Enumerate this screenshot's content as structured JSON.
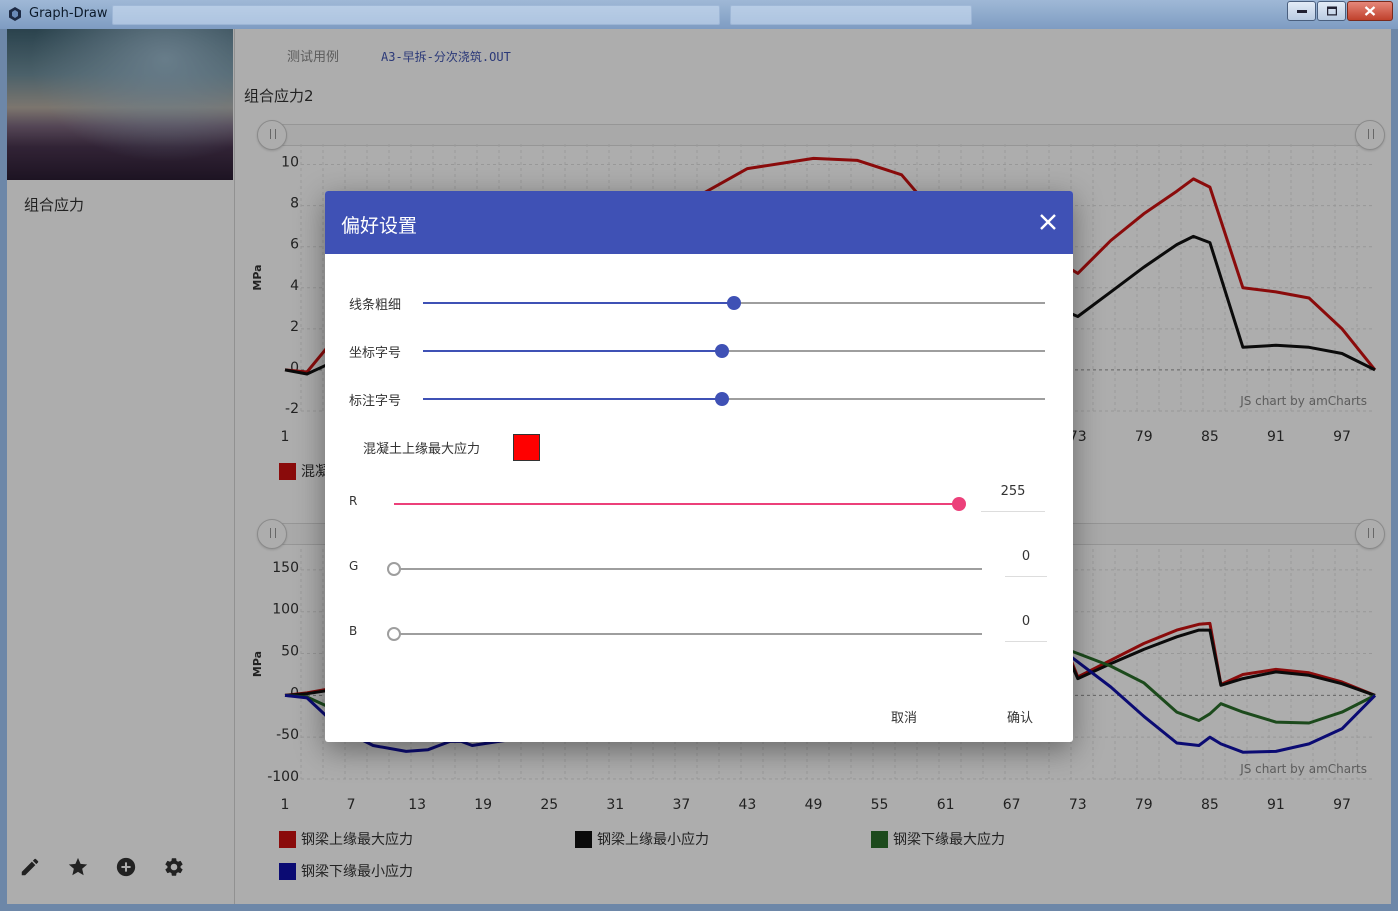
{
  "window": {
    "title": "Graph-Draw"
  },
  "sidebar": {
    "item": "组合应力"
  },
  "tabs": {
    "test_cases": "测试用例",
    "file": "A3-早拆-分次浇筑.OUT"
  },
  "chart_title": "组合应力2",
  "chart_data": [
    {
      "type": "line",
      "ylabel": "MPa",
      "yticks": [
        "10",
        "8",
        "6",
        "4",
        "2",
        "0",
        "-2"
      ],
      "xticks": [
        "1",
        "73",
        "79",
        "85",
        "91",
        "97"
      ],
      "ylim": [
        -2,
        11
      ],
      "legend_visible": [
        "混凝"
      ],
      "credit": "JS chart by amCharts",
      "series": [
        {
          "color": "#cc1111",
          "x": [
            1,
            3,
            5,
            7,
            37,
            43,
            49,
            53,
            57,
            61,
            65,
            69,
            73,
            76,
            79,
            82,
            83.5,
            85,
            88,
            91,
            94,
            97,
            100
          ],
          "y": [
            0,
            -0.1,
            1.2,
            2.5,
            8,
            9.8,
            10.3,
            10.2,
            9.5,
            7,
            3.8,
            6,
            4.7,
            6.3,
            7.6,
            8.7,
            9.3,
            8.9,
            4,
            3.8,
            3.5,
            2,
            0
          ]
        },
        {
          "color": "#111111",
          "x": [
            1,
            3,
            5,
            7,
            69,
            73,
            76,
            79,
            82,
            83.5,
            85,
            88,
            91,
            94,
            97,
            100
          ],
          "y": [
            0,
            -0.2,
            0.3,
            0.6,
            3.5,
            2.6,
            3.8,
            5,
            6.1,
            6.5,
            6.2,
            1.1,
            1.2,
            1.1,
            0.8,
            0
          ]
        }
      ]
    },
    {
      "type": "line",
      "ylabel": "MPa",
      "yticks": [
        "150",
        "100",
        "50",
        "0",
        "-50",
        "-100"
      ],
      "xticks": [
        "1",
        "7",
        "13",
        "19",
        "25",
        "31",
        "37",
        "43",
        "49",
        "55",
        "61",
        "67",
        "73",
        "79",
        "85",
        "91",
        "97"
      ],
      "ylim": [
        -100,
        175
      ],
      "credit": "JS chart by amCharts",
      "series": [
        {
          "name": "钢梁上缘最大应力",
          "color": "#cc1111",
          "x": [
            1,
            3,
            6,
            9,
            72,
            73,
            76,
            79,
            82,
            84,
            85,
            86,
            88,
            91,
            94,
            97,
            100
          ],
          "y": [
            0,
            3,
            10,
            20,
            55,
            22,
            42,
            62,
            78,
            85,
            86,
            13,
            25,
            31,
            27,
            16,
            0
          ]
        },
        {
          "name": "钢梁上缘最小应力",
          "color": "#111111",
          "x": [
            1,
            3,
            6,
            9,
            72,
            73,
            76,
            79,
            82,
            84,
            85,
            86,
            88,
            91,
            94,
            97,
            100
          ],
          "y": [
            0,
            2,
            8,
            15,
            50,
            20,
            38,
            55,
            70,
            78,
            78,
            12,
            20,
            28,
            24,
            14,
            0
          ]
        },
        {
          "name": "钢梁下缘最大应力",
          "color": "#2a6e2a",
          "x": [
            1,
            3,
            6,
            9,
            72,
            73,
            76,
            79,
            82,
            84,
            85,
            86,
            88,
            91,
            94,
            97,
            100
          ],
          "y": [
            0,
            -2,
            -20,
            -35,
            55,
            50,
            35,
            15,
            -20,
            -30,
            -22,
            -10,
            -20,
            -32,
            -33,
            -20,
            0
          ]
        },
        {
          "name": "钢梁下缘最小应力",
          "color": "#1111aa",
          "x": [
            1,
            3,
            6,
            9,
            12,
            14,
            15,
            16,
            17,
            18,
            72,
            73,
            76,
            79,
            82,
            84,
            85,
            86,
            88,
            91,
            94,
            97,
            100
          ],
          "y": [
            0,
            -3,
            -40,
            -60,
            -67,
            -65,
            -60,
            -55,
            -55,
            -60,
            50,
            40,
            10,
            -25,
            -57,
            -60,
            -50,
            -58,
            -68,
            -67,
            -58,
            -40,
            0
          ]
        }
      ]
    }
  ],
  "dialog": {
    "title": "偏好设置",
    "line_width_label": "线条粗细",
    "line_width": 0.5,
    "axis_font_label": "坐标字号",
    "axis_font": 0.48,
    "annot_font_label": "标注字号",
    "annot_font": 0.48,
    "series_label": "混凝土上缘最大应力",
    "swatch_color": "#ff0000",
    "r_label": "R",
    "r_value": "255",
    "g_label": "G",
    "g_value": "0",
    "b_label": "B",
    "b_value": "0",
    "cancel": "取消",
    "confirm": "确认"
  }
}
